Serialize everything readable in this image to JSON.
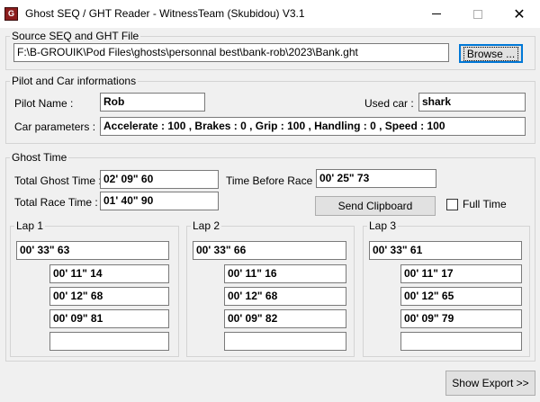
{
  "window": {
    "icon_text": "G",
    "title": "Ghost SEQ / GHT Reader - WitnessTeam (Skubidou) V3.1",
    "close_glyph": "✕"
  },
  "source": {
    "legend": "Source SEQ and GHT File",
    "path": "F:\\B-GROUIK\\Pod Files\\ghosts\\personnal best\\bank-rob\\2023\\Bank.ght",
    "browse_label": "Browse ..."
  },
  "pilot": {
    "legend": "Pilot and Car informations",
    "pilot_name_label": "Pilot Name :",
    "pilot_name": "Rob",
    "used_car_label": "Used car :",
    "used_car": "shark",
    "car_params_label": "Car parameters :",
    "car_params": "Accelerate : 100 , Brakes : 0 , Grip : 100 , Handling : 0 , Speed : 100"
  },
  "ghost": {
    "legend": "Ghost Time",
    "total_ghost_label": "Total Ghost Time :",
    "total_ghost": "02' 09\" 60",
    "time_before_race_label": "Time Before Race :",
    "time_before_race": "00' 25\" 73",
    "total_race_label": "Total Race Time :",
    "total_race": "01' 40\" 90",
    "send_clipboard_label": "Send Clipboard",
    "full_time_label": "Full Time",
    "full_time_checked": false
  },
  "laps": [
    {
      "legend": "Lap 1",
      "total": "00' 33\" 63",
      "splits": [
        "00' 11\" 14",
        "00' 12\" 68",
        "00' 09\" 81",
        ""
      ]
    },
    {
      "legend": "Lap 2",
      "total": "00' 33\" 66",
      "splits": [
        "00' 11\" 16",
        "00' 12\" 68",
        "00' 09\" 82",
        ""
      ]
    },
    {
      "legend": "Lap 3",
      "total": "00' 33\" 61",
      "splits": [
        "00' 11\" 17",
        "00' 12\" 65",
        "00' 09\" 79",
        ""
      ]
    }
  ],
  "footer": {
    "show_export_label": "Show Export >>"
  }
}
